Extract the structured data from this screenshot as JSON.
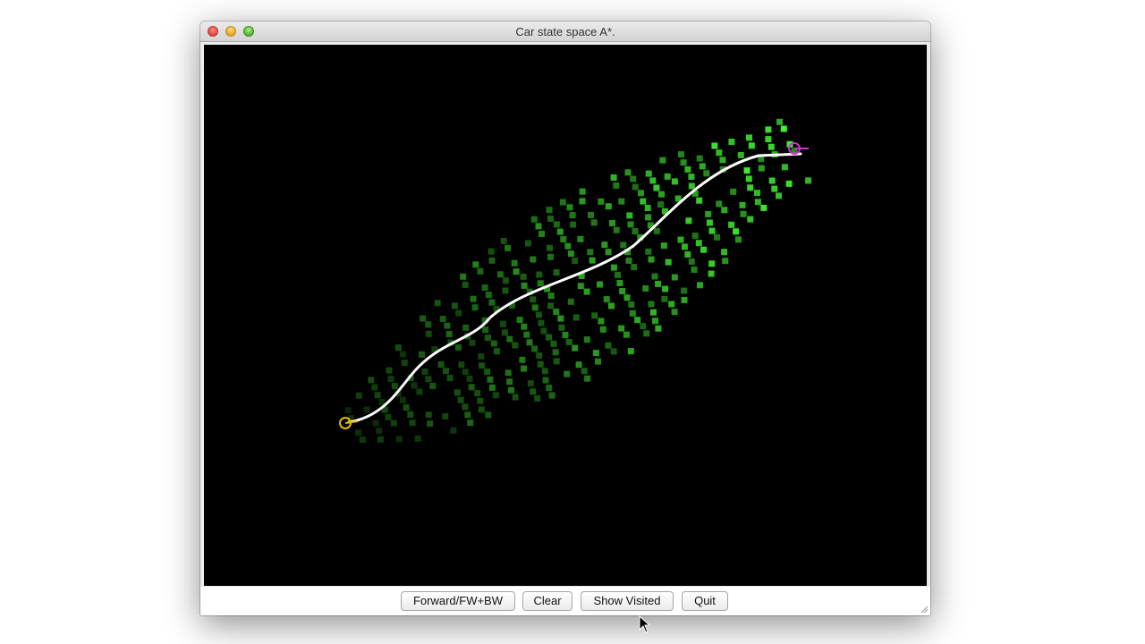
{
  "window": {
    "title": "Car state space A*."
  },
  "canvas": {
    "background_color": "#000000",
    "visited_color": "#44ff33",
    "path_color": "#ffffff",
    "start_marker_color": "#e6b800",
    "goal_marker_color": "#cc33cc"
  },
  "buttons": {
    "forward": "Forward/FW+BW",
    "clear": "Clear",
    "show_visited": "Show Visited",
    "quit": "Quit"
  }
}
